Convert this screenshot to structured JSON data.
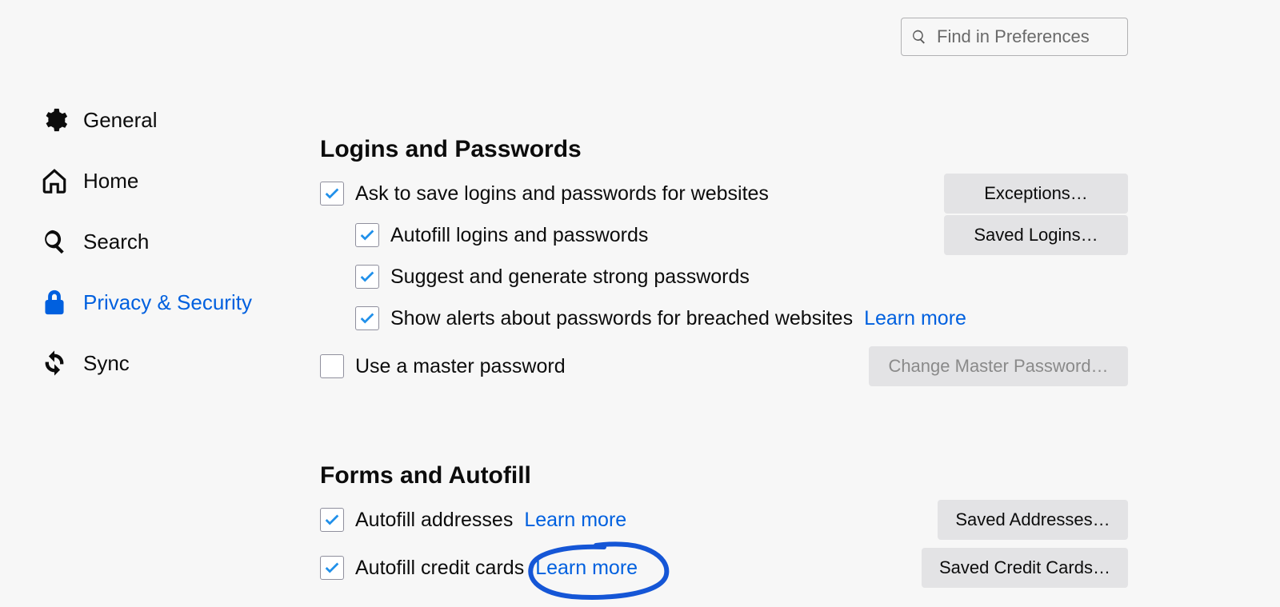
{
  "search": {
    "placeholder": "Find in Preferences"
  },
  "sidebar": {
    "items": [
      {
        "label": "General"
      },
      {
        "label": "Home"
      },
      {
        "label": "Search"
      },
      {
        "label": "Privacy & Security"
      },
      {
        "label": "Sync"
      }
    ]
  },
  "sections": {
    "logins": {
      "title": "Logins and Passwords",
      "ask_save": "Ask to save logins and passwords for websites",
      "autofill_logins": "Autofill logins and passwords",
      "suggest_strong": "Suggest and generate strong passwords",
      "breach_alerts": "Show alerts about passwords for breached websites",
      "learn_more": "Learn more",
      "use_master": "Use a master password",
      "btn_exceptions": "Exceptions…",
      "btn_saved_logins": "Saved Logins…",
      "btn_change_master": "Change Master Password…"
    },
    "forms": {
      "title": "Forms and Autofill",
      "autofill_addresses": "Autofill addresses",
      "learn_more_addr": "Learn more",
      "autofill_cards": "Autofill credit cards",
      "learn_more_cards": "Learn more",
      "btn_saved_addresses": "Saved Addresses…",
      "btn_saved_cards": "Saved Credit Cards…"
    }
  }
}
